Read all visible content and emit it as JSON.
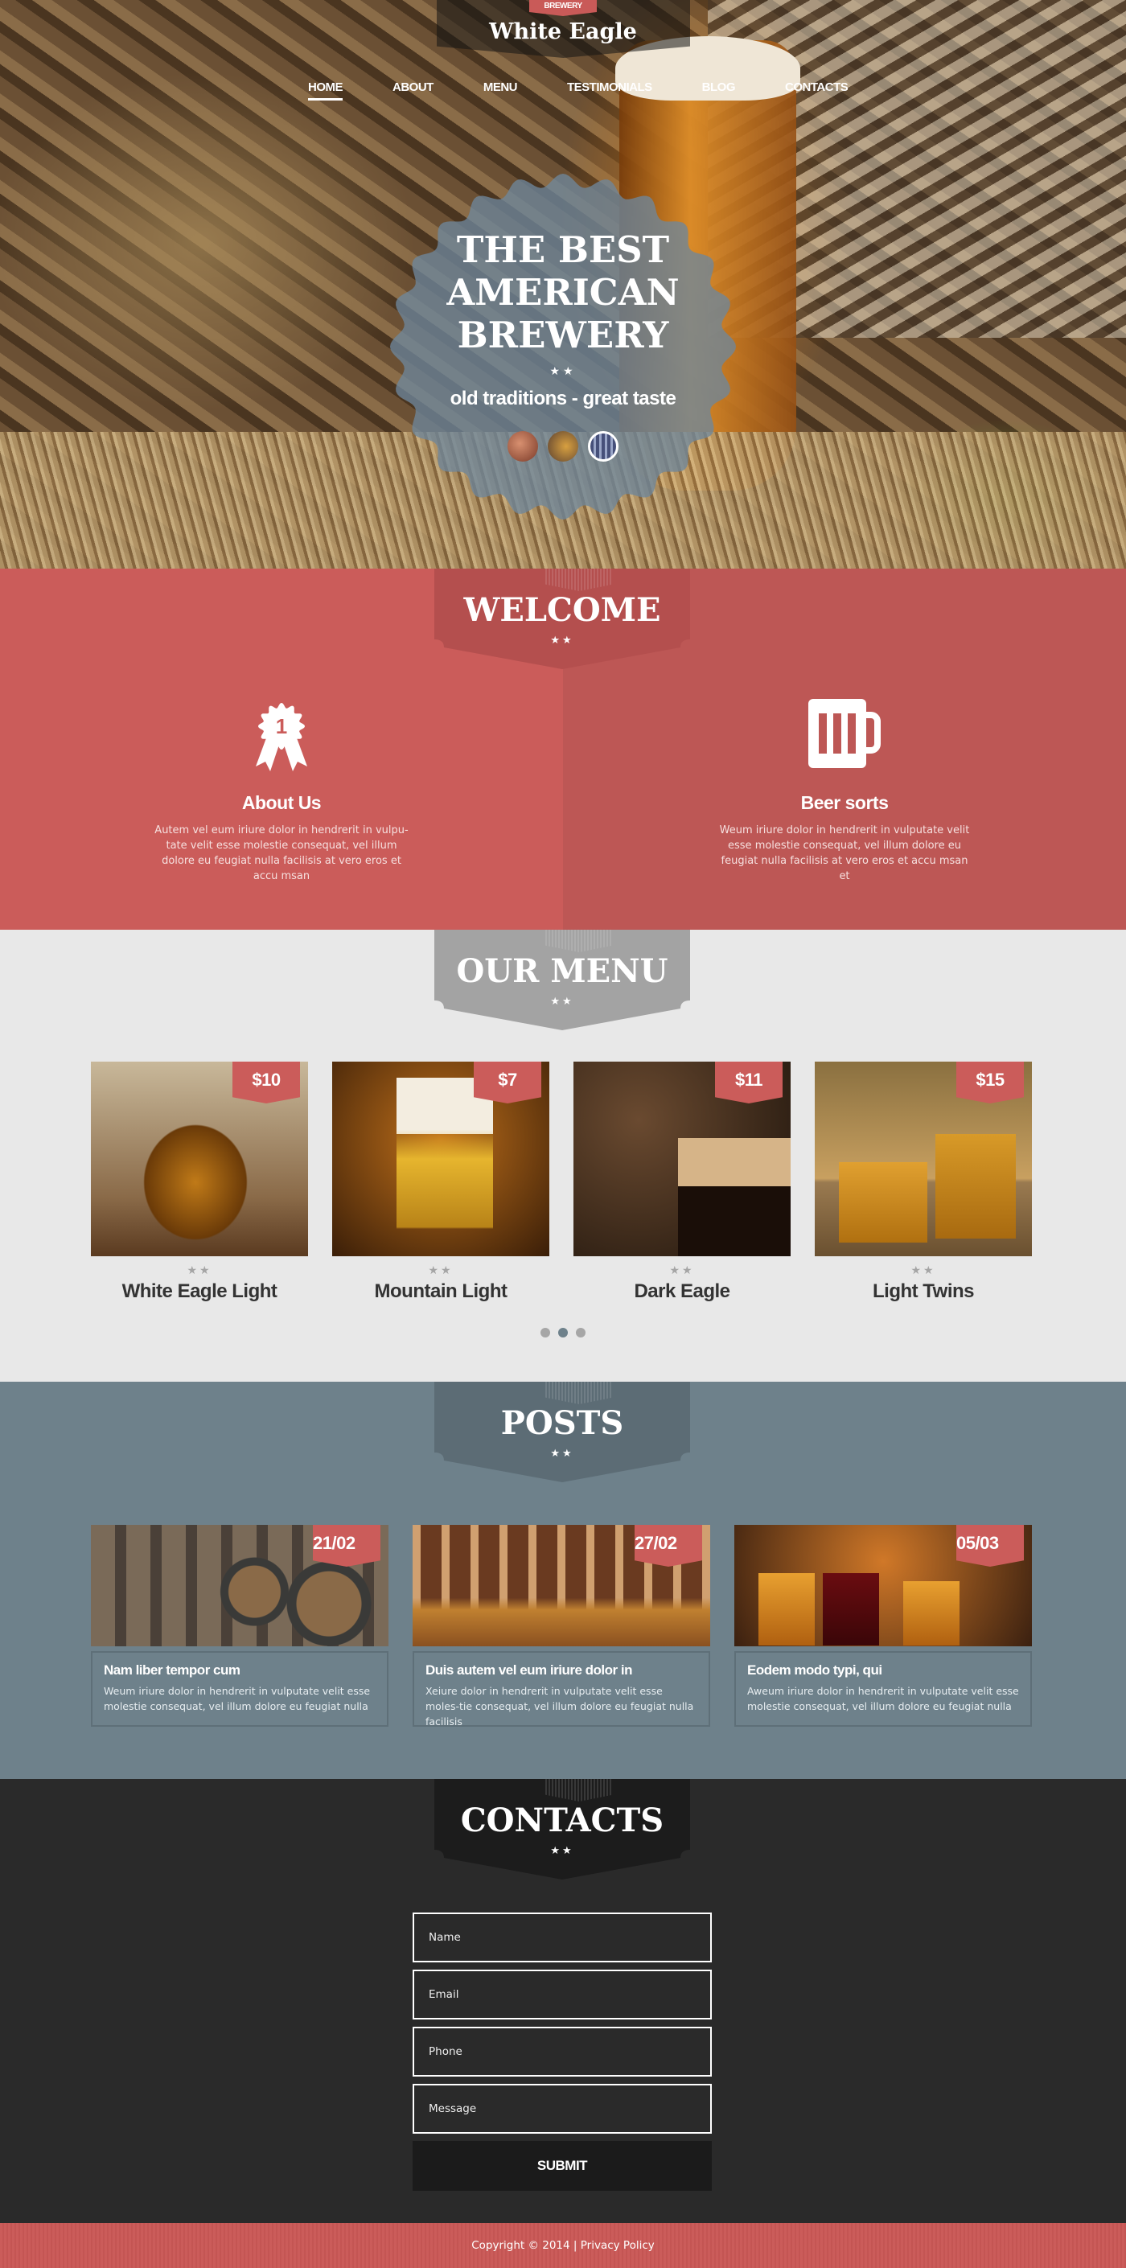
{
  "header": {
    "tag": "BREWERY",
    "brand": "White Eagle",
    "nav": [
      {
        "label": "HOME",
        "active": true
      },
      {
        "label": "ABOUT"
      },
      {
        "label": "MENU"
      },
      {
        "label": "TESTIMONIALS"
      },
      {
        "label": "BLOG"
      },
      {
        "label": "CONTACTS"
      }
    ]
  },
  "hero": {
    "title_lines": [
      "THE BEST",
      "AMERICAN",
      "BREWERY"
    ],
    "stars": "★★",
    "tagline": "old traditions - great taste",
    "slides": [
      "brewing-kettles",
      "barrel-and-beer",
      "beer-taps"
    ],
    "active_slide": 2
  },
  "welcome": {
    "title": "WELCOME",
    "stars": "★★",
    "features": [
      {
        "icon": "award-ribbon-icon",
        "icon_text": "1",
        "title": "About Us",
        "text": "Autem vel eum iriure dolor in hendrerit in vulpu-tate velit esse molestie consequat, vel illum dolore eu feugiat nulla facilisis at vero eros et accu msan"
      },
      {
        "icon": "beer-mug-icon",
        "title": "Beer sorts",
        "text": "Weum iriure dolor in hendrerit in vulputate velit esse molestie consequat, vel illum dolore eu feugiat nulla facilisis at vero eros et accu msan et"
      }
    ]
  },
  "menu": {
    "title": "OUR MENU",
    "stars": "★★",
    "items": [
      {
        "name": "White Eagle Light",
        "price": "$10",
        "stars": "★★"
      },
      {
        "name": "Mountain Light",
        "price": "$7",
        "stars": "★★"
      },
      {
        "name": "Dark Eagle",
        "price": "$11",
        "stars": "★★"
      },
      {
        "name": "Light Twins",
        "price": "$15",
        "stars": "★★"
      }
    ],
    "pages": 3,
    "active_page": 2
  },
  "posts": {
    "title": "POSTS",
    "stars": "★★",
    "items": [
      {
        "date": "21/02",
        "title": "Nam liber tempor cum",
        "text": "Weum iriure dolor in hendrerit in vulputate velit esse molestie consequat, vel illum dolore eu feugiat nulla"
      },
      {
        "date": "27/02",
        "title": "Duis autem vel eum iriure dolor in",
        "text": "Xeiure dolor in hendrerit in vulputate velit esse moles-tie consequat, vel illum dolore eu feugiat nulla facilisis"
      },
      {
        "date": "05/03",
        "title": "Eodem modo typi, qui",
        "text": "Aweum iriure dolor in hendrerit in vulputate velit esse molestie consequat, vel illum dolore eu feugiat nulla"
      }
    ]
  },
  "contacts": {
    "title": "CONTACTS",
    "stars": "★★",
    "fields": {
      "name": "Name",
      "email": "Email",
      "phone": "Phone",
      "message": "Message"
    },
    "submit": "SUBMIT"
  },
  "footer": {
    "copyright": "Copyright © 2014",
    "separator": "|",
    "privacy": "Privacy Policy"
  },
  "colors": {
    "accent": "#cb5c5a",
    "slate": "#6e818b",
    "light": "#e8e8e8",
    "dark": "#2a2a2a"
  }
}
